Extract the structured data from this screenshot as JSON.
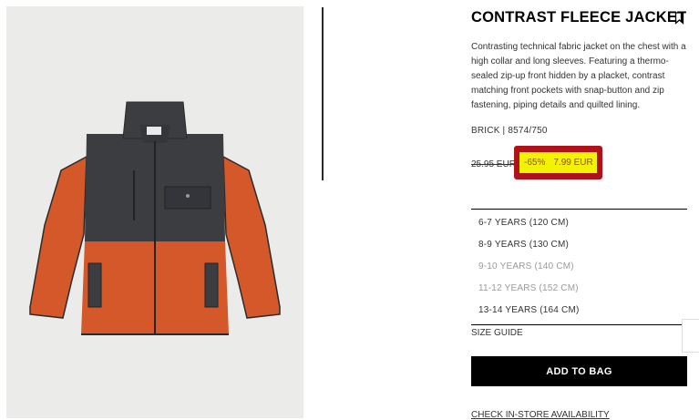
{
  "product": {
    "title": "CONTRAST FLEECE JACKET",
    "description": "Contrasting technical fabric jacket on the chest with a high collar and long sleeves. Featuring a thermo-sealed zip-up front hidden by a placket, contrast matching front pockets with snap-button and zip fastening, piping details and quilted lining.",
    "color_ref": "BRICK | 8574/750"
  },
  "price": {
    "original": "25.95 EUR",
    "discount": "-65%",
    "sale": "7.99 EUR"
  },
  "sizes": [
    {
      "label": "6-7 YEARS (120 CM)",
      "available": true
    },
    {
      "label": "8-9 YEARS (130 CM)",
      "available": true
    },
    {
      "label": "9-10 YEARS (140 CM)",
      "available": false
    },
    {
      "label": "11-12 YEARS (152 CM)",
      "available": false
    },
    {
      "label": "13-14 YEARS (164 CM)",
      "available": true
    }
  ],
  "actions": {
    "size_guide": "SIZE GUIDE",
    "add_to_bag": "ADD TO BAG",
    "store_availability": "CHECK IN-STORE AVAILABILITY"
  },
  "icons": {
    "bookmark": "bookmark-icon"
  },
  "colors": {
    "jacket_orange": "#d4582a",
    "jacket_dark": "#3b3d40",
    "highlight_yellow": "#f3f200",
    "highlight_border": "#b0121b"
  }
}
